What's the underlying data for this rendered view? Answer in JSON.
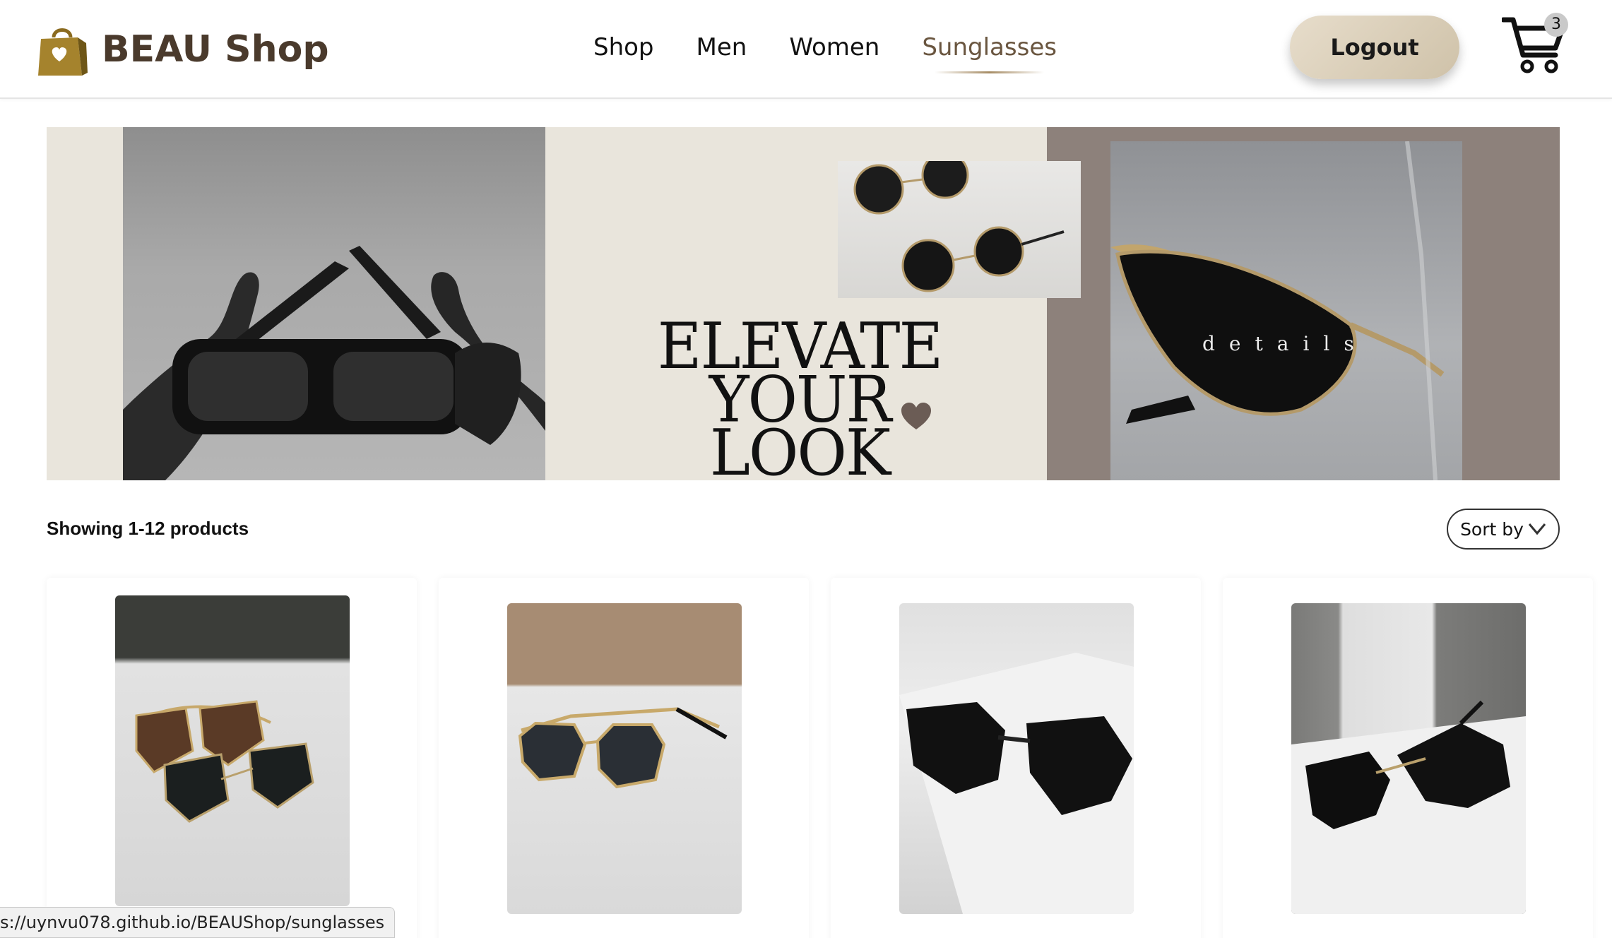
{
  "brand": {
    "name": "BEAU Shop",
    "icon": "shopping-bag-heart-icon",
    "color": "#4a3a2c"
  },
  "nav": {
    "items": [
      {
        "label": "Shop"
      },
      {
        "label": "Men"
      },
      {
        "label": "Women"
      },
      {
        "label": "Sunglasses",
        "active": true
      }
    ]
  },
  "header": {
    "logout_label": "Logout",
    "cart_count": "3",
    "cart_icon": "cart-icon"
  },
  "banner": {
    "headline_line1": "ELEVATE YOUR",
    "headline_line2": "LOOK",
    "details_text": "details",
    "heart_icon": "heart-icon"
  },
  "toolbar": {
    "count_text": "Showing 1-12 products",
    "sort_label": "Sort by",
    "sort_icon": "chevron-down-icon"
  },
  "products": [
    {
      "image": "two-pairs-square-sunglasses-photo"
    },
    {
      "image": "gold-frame-hexagon-sunglasses-photo"
    },
    {
      "image": "black-oversized-butterfly-sunglasses-photo"
    },
    {
      "image": "black-cat-eye-sunglasses-photo"
    }
  ],
  "status_bar": {
    "url": "s://uynvu078.github.io/BEAUShop/sunglasses"
  },
  "colors": {
    "accent": "#a68c64",
    "button_bg": "#ddd2bd",
    "banner_bg": "#e9e5dc",
    "banner_right": "#8d817b"
  }
}
